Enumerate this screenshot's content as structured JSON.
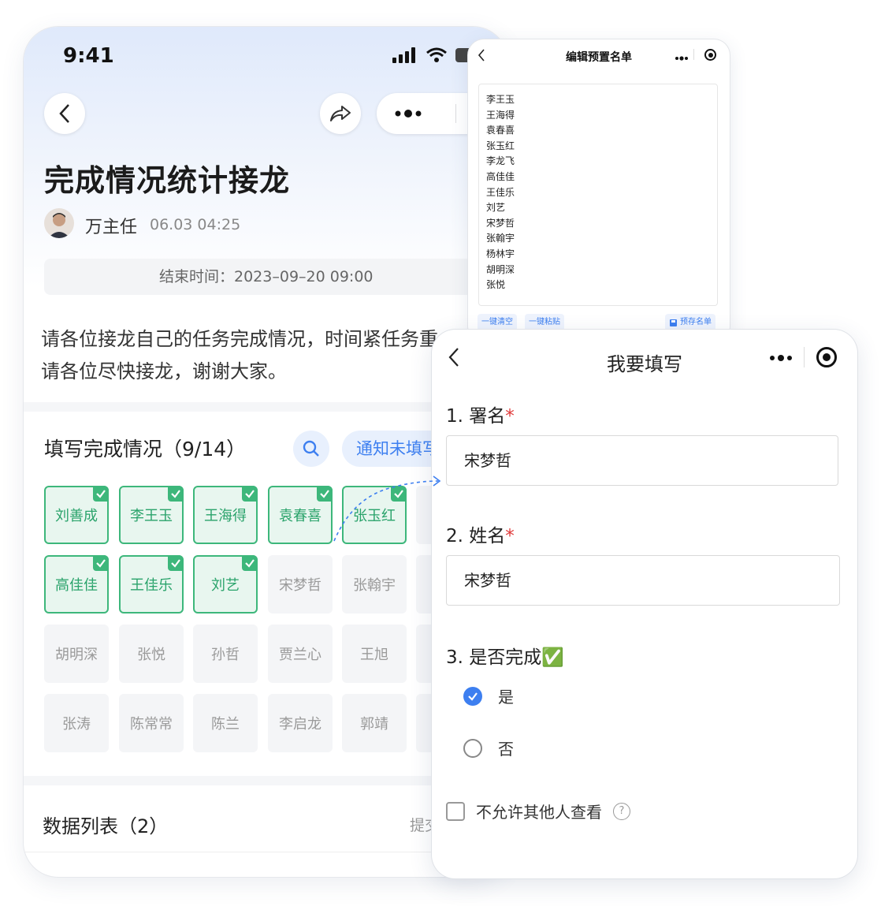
{
  "main": {
    "status_time": "9:41",
    "title": "完成情况统计接龙",
    "author": "万主任",
    "publish_time": "06.03 04:25",
    "end_time": "结束时间：2023–09–20 09:00",
    "description_line1": "请各位接龙自己的任务完成情况，时间紧任务重",
    "description_line2": "请各位尽快接龙，谢谢大家。",
    "section_title": "填写完成情况（9/14）",
    "notify_label": "通知未填写",
    "chips": [
      {
        "name": "刘善成",
        "done": true
      },
      {
        "name": "李王玉",
        "done": true
      },
      {
        "name": "王海得",
        "done": true
      },
      {
        "name": "袁春喜",
        "done": true
      },
      {
        "name": "张玉红",
        "done": true
      },
      {
        "name": "高佳佳",
        "done": true
      },
      {
        "name": "王佳乐",
        "done": true
      },
      {
        "name": "刘艺",
        "done": true
      },
      {
        "name": "宋梦哲",
        "done": false
      },
      {
        "name": "张翰宇",
        "done": false
      },
      {
        "name": "胡明深",
        "done": false
      },
      {
        "name": "张悦",
        "done": false
      },
      {
        "name": "孙哲",
        "done": false
      },
      {
        "name": "贾兰心",
        "done": false
      },
      {
        "name": "王旭",
        "done": false
      },
      {
        "name": "张涛",
        "done": false
      },
      {
        "name": "陈常常",
        "done": false
      },
      {
        "name": "陈兰",
        "done": false
      },
      {
        "name": "李启龙",
        "done": false
      },
      {
        "name": "郭靖",
        "done": false
      }
    ],
    "list_title": "数据列表（2）",
    "list_right": "提交"
  },
  "preset": {
    "title": "编辑预置名单",
    "names": [
      "李王玉",
      "王海得",
      "袁春喜",
      "张玉红",
      "李龙飞",
      "高佳佳",
      "王佳乐",
      "刘艺",
      "宋梦哲",
      "张翰宇",
      "杨林宇",
      "胡明深",
      "张悦"
    ],
    "clear_label": "一键清空",
    "paste_label": "一键粘贴",
    "save_label": "预存名单"
  },
  "form": {
    "title": "我要填写",
    "q1_label": "1. 署名",
    "q1_value": "宋梦哲",
    "q2_label": "2. 姓名",
    "q2_value": "宋梦哲",
    "q3_label": "3. 是否完成✅",
    "option_yes": "是",
    "option_no": "否",
    "option_selected": "是",
    "private_label": "不允许其他人查看",
    "required_mark": "*"
  },
  "colors": {
    "accent": "#3d7ff0",
    "done_green": "#3db77b",
    "required_red": "#e03a3a"
  }
}
